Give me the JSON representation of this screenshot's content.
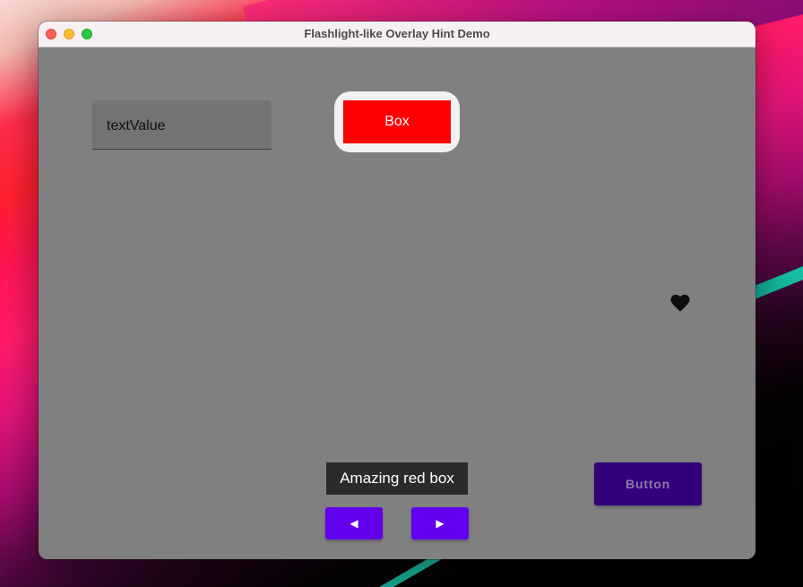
{
  "window": {
    "title": "Flashlight-like Overlay Hint Demo"
  },
  "text_field": {
    "value": "textValue"
  },
  "red_box": {
    "label": "Box"
  },
  "hint": {
    "text": "Amazing red box"
  },
  "navigation": {
    "prev_label": "◀",
    "next_label": "▶"
  },
  "button": {
    "label": "Button"
  },
  "icons": [
    "heart-icon"
  ],
  "colors": {
    "overlay": "#808080",
    "red_box": "#ff0000",
    "hint_bg": "#2b2b2b",
    "nav_button": "#6200ee",
    "dimmed_button": "#31017a"
  }
}
